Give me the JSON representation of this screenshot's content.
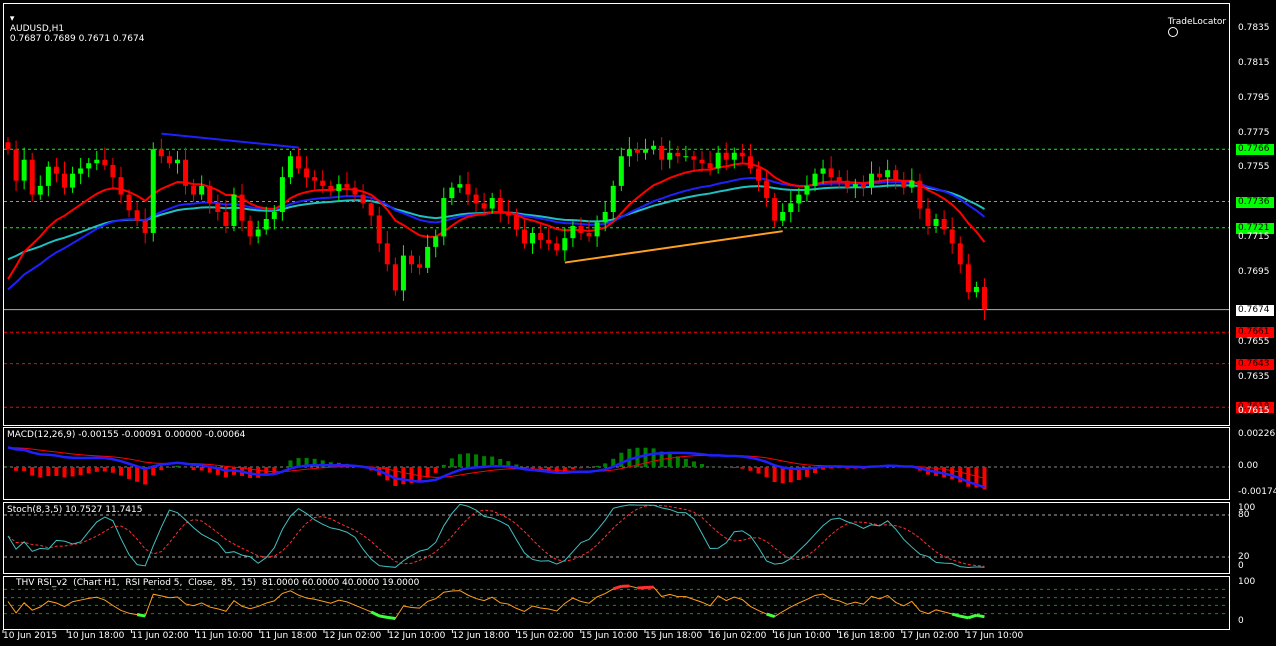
{
  "header": {
    "symbol_label": "AUDUSD,H1",
    "ohlc": "0.7687 0.7689 0.7671 0.7674",
    "brand": "TradeLocator"
  },
  "price_axis": {
    "ticks": [
      "0.7835",
      "0.7815",
      "0.7795",
      "0.7775",
      "0.7755",
      "0.7715",
      "0.7695",
      "0.7655",
      "0.7635",
      "0.7615"
    ],
    "tick_values": [
      0.7835,
      0.7815,
      0.7795,
      0.7775,
      0.7755,
      0.7715,
      0.7695,
      0.7655,
      0.7635,
      0.7615
    ],
    "levels": [
      {
        "label": "0.7766",
        "value": 0.7766,
        "color": "#00ff00"
      },
      {
        "label": "0.7736",
        "value": 0.7736,
        "color": "#00ff00"
      },
      {
        "label": "0.7721",
        "value": 0.7721,
        "color": "#00ff00"
      },
      {
        "label": "0.7661",
        "value": 0.7661,
        "color": "#ff0000"
      },
      {
        "label": "0.7643",
        "value": 0.7643,
        "color": "#ff0000"
      },
      {
        "label": "0.7618",
        "value": 0.7618,
        "color": "#ff0000"
      }
    ],
    "current": {
      "label": "0.7674",
      "value": 0.7674
    }
  },
  "macd": {
    "label": "MACD(12,26,9) -0.00155 -0.00091 0.00000 -0.00064",
    "ticks": [
      "0.00226",
      "0.00",
      "-0.00174"
    ]
  },
  "stoch": {
    "label": "Stoch(8,3,5) 10.7527 11.7415",
    "ticks": [
      "100",
      "80",
      "20",
      "0"
    ]
  },
  "rsi": {
    "label": "THV RSI_v2  (Chart H1,  RSI Period 5,  Close,  85,  15)  81.0000 60.0000 40.0000 19.0000",
    "ticks": [
      "100",
      "0"
    ]
  },
  "time_axis": [
    "10 Jun 2015",
    "10 Jun 18:00",
    "11 Jun 02:00",
    "11 Jun 10:00",
    "11 Jun 18:00",
    "12 Jun 02:00",
    "12 Jun 10:00",
    "12 Jun 18:00",
    "15 Jun 02:00",
    "15 Jun 10:00",
    "15 Jun 18:00",
    "16 Jun 02:00",
    "16 Jun 10:00",
    "16 Jun 18:00",
    "17 Jun 02:00",
    "17 Jun 10:00"
  ],
  "colors": {
    "bull": "#00ff00",
    "bear": "#ff0000",
    "ma_fast": "#ff0000",
    "ma_mid": "#2020ff",
    "ma_slow": "#20c0c0",
    "trend1": "#2020ff",
    "trend2": "#ffa020"
  },
  "chart_data": {
    "type": "candlestick",
    "symbol": "AUDUSD",
    "timeframe": "H1",
    "closes": [
      0.7766,
      0.7748,
      0.776,
      0.774,
      0.7745,
      0.7756,
      0.7752,
      0.7744,
      0.7752,
      0.7755,
      0.7758,
      0.776,
      0.7757,
      0.775,
      0.774,
      0.7731,
      0.7725,
      0.7718,
      0.7766,
      0.7762,
      0.7758,
      0.776,
      0.7745,
      0.774,
      0.7745,
      0.7735,
      0.773,
      0.7722,
      0.774,
      0.7725,
      0.7716,
      0.772,
      0.7726,
      0.773,
      0.775,
      0.7762,
      0.7755,
      0.775,
      0.7748,
      0.7745,
      0.7742,
      0.7746,
      0.7744,
      0.774,
      0.7735,
      0.7728,
      0.7712,
      0.77,
      0.7685,
      0.7705,
      0.77,
      0.7698,
      0.771,
      0.7716,
      0.7738,
      0.7744,
      0.7746,
      0.774,
      0.7735,
      0.7732,
      0.7738,
      0.773,
      0.7728,
      0.772,
      0.7712,
      0.7718,
      0.7714,
      0.7712,
      0.7708,
      0.7715,
      0.7722,
      0.7718,
      0.7716,
      0.7724,
      0.773,
      0.7745,
      0.7762,
      0.7766,
      0.7764,
      0.7766,
      0.7768,
      0.776,
      0.7764,
      0.7762,
      0.7762,
      0.776,
      0.7758,
      0.7755,
      0.7764,
      0.776,
      0.7764,
      0.7762,
      0.7755,
      0.7748,
      0.7738,
      0.7725,
      0.773,
      0.7735,
      0.774,
      0.7745,
      0.7752,
      0.7755,
      0.775,
      0.7748,
      0.7744,
      0.7746,
      0.7744,
      0.7752,
      0.775,
      0.7754,
      0.7748,
      0.7744,
      0.7748,
      0.7732,
      0.7722,
      0.7726,
      0.772,
      0.7712,
      0.77,
      0.7684,
      0.7687,
      0.7674
    ],
    "first_open": 0.777,
    "ma_seeds": {
      "fast": 0.768,
      "mid": 0.768,
      "slow": 0.77
    },
    "trendlines": [
      {
        "from": [
          19,
          0.7775
        ],
        "to": [
          36,
          0.7767
        ],
        "color": "trend1"
      },
      {
        "from": [
          69,
          0.7701
        ],
        "to": [
          96,
          0.7719
        ],
        "color": "trend2"
      }
    ],
    "ylim": [
      0.7605,
      0.785
    ]
  }
}
